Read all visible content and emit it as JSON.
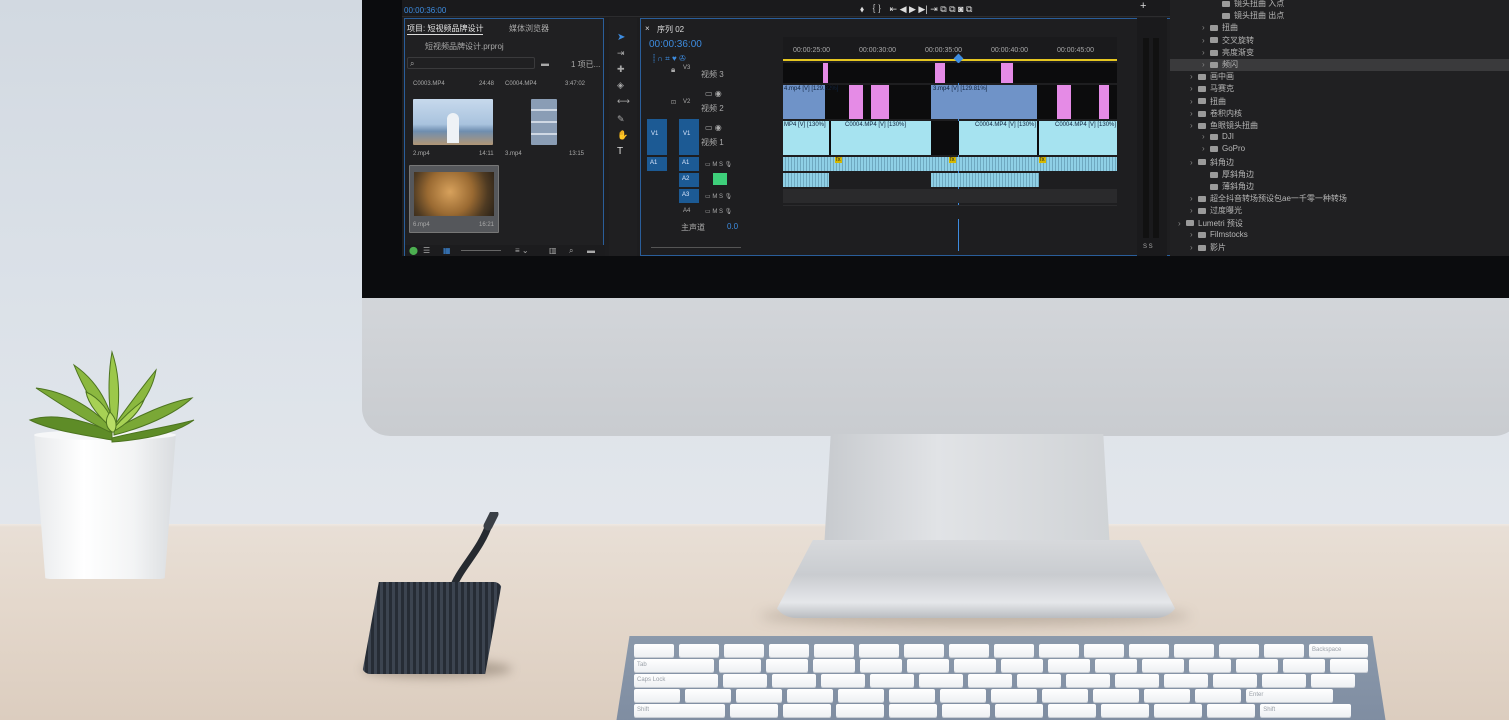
{
  "colors": {
    "wall": "#d4dbe3",
    "desk": "#e4d8cc",
    "accent_blue": "#2a5e9a",
    "clip_video": "#a6e3f0",
    "clip_magenta": "#e58be6",
    "clip_steel": "#6f93c8"
  },
  "screen": {
    "top_timecode": "00:00:36:00",
    "project_panel": {
      "tab_project": "项目: 短视频品牌设计",
      "tab_media": "媒体浏览器",
      "project_file": "短视频品牌设计.prproj",
      "item_count": "1 项已...",
      "clips": [
        {
          "name": "C0003.MP4",
          "duration": "24:48"
        },
        {
          "name": "C0004.MP4",
          "duration": "3:47:02"
        },
        {
          "name": "2.mp4",
          "duration": "14:11"
        },
        {
          "name": "3.mp4",
          "duration": "13:15"
        },
        {
          "name": "6.mp4",
          "duration": "16:21"
        }
      ]
    },
    "timeline": {
      "sequence_name": "序列 02",
      "timecode": "00:00:36:00",
      "ruler": [
        "00:00:25:00",
        "00:00:30:00",
        "00:00:35:00",
        "00:00:40:00",
        "00:00:45:00"
      ],
      "tracks": {
        "v3": "V3",
        "v3_name": "视频 3",
        "v2": "V2",
        "v2_name": "视频 2",
        "v1": "V1",
        "v1_name": "视频 1",
        "a1": "A1",
        "a2": "A2",
        "a3": "A3",
        "a4": "A4",
        "master": "主声道",
        "master_value": "0.0"
      },
      "clip_labels": {
        "v2_a": "4.mp4 [V] [129.82%]",
        "v2_b": "3.mp4 [V] [129.81%]",
        "v1_a": "MP4 [V] [130%]",
        "v1_b": "C0004.MP4 [V] [130%]",
        "v1_c": "C0004.MP4 [V] [130%]",
        "v1_d": "C0004.MP4 [V] [130%]"
      },
      "fx_badge": "fx",
      "meter_labels": "S S"
    },
    "effects_panel": {
      "items": [
        {
          "label": "镜头扭曲 入点",
          "indent": 3
        },
        {
          "label": "镜头扭曲 出点",
          "indent": 3
        },
        {
          "label": "扭曲",
          "indent": 2
        },
        {
          "label": "交叉旋转",
          "indent": 2
        },
        {
          "label": "亮度渐变",
          "indent": 2
        },
        {
          "label": "频闪",
          "indent": 2
        },
        {
          "label": "画中画",
          "indent": 1
        },
        {
          "label": "马赛克",
          "indent": 1
        },
        {
          "label": "扭曲",
          "indent": 1
        },
        {
          "label": "卷积内核",
          "indent": 1
        },
        {
          "label": "鱼眼镜头扭曲",
          "indent": 1
        },
        {
          "label": "DJI",
          "indent": 2
        },
        {
          "label": "GoPro",
          "indent": 2
        },
        {
          "label": "斜角边",
          "indent": 1
        },
        {
          "label": "厚斜角边",
          "indent": 2
        },
        {
          "label": "薄斜角边",
          "indent": 2
        },
        {
          "label": "超全抖音转场预设包ae一千零一种转场",
          "indent": 1
        },
        {
          "label": "过度曝光",
          "indent": 1
        },
        {
          "label": "Lumetri 预设",
          "indent": 0
        },
        {
          "label": "Filmstocks",
          "indent": 1
        },
        {
          "label": "影片",
          "indent": 1
        }
      ]
    }
  },
  "keyboard": {
    "keys": [
      "Backspace",
      "Tab",
      "Caps Lock",
      "Enter",
      "Shift",
      "Shift"
    ]
  }
}
